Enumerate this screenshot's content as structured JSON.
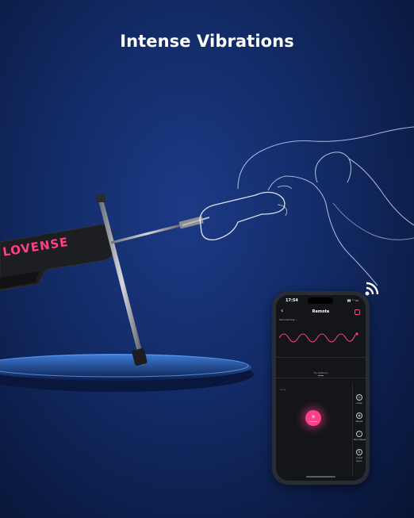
{
  "headline": "Intense Vibrations",
  "brand": "LOVENSE",
  "phone": {
    "time": "17:54",
    "status_icons": "▮▮ ◠ ▭",
    "back_icon": "chevron-left-icon",
    "back_glyph": "‹",
    "title": "Remote",
    "device_name": "Sex machine ...",
    "tab_label": "Try patterns",
    "sensitivity_label": "Sens",
    "control_glyph": "≋",
    "control_label": "Vibrations",
    "tools": [
      {
        "icon": "loop-icon",
        "glyph": "◎",
        "label": "Loop"
      },
      {
        "icon": "pause-icon",
        "glyph": "◉",
        "label": "Pause"
      },
      {
        "icon": "touch-icon",
        "glyph": "☝",
        "label": "Touchboard"
      },
      {
        "icon": "sync-icon",
        "glyph": "⇅",
        "label": "Local Sync"
      }
    ]
  },
  "colors": {
    "accent": "#ff3f8a",
    "background": "#132c69",
    "phone_screen": "#141518"
  }
}
